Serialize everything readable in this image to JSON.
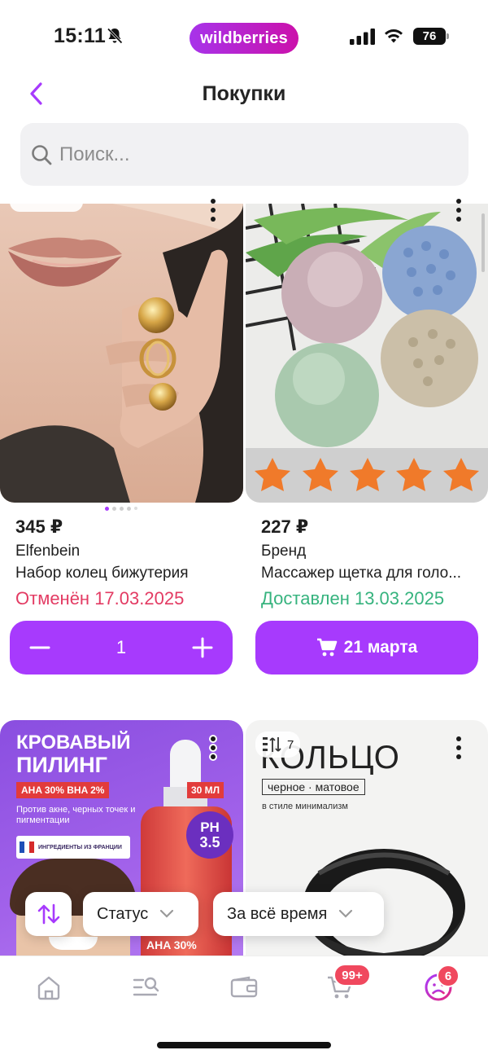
{
  "status_bar": {
    "time": "15:11",
    "brand": "wildberries",
    "battery": "76"
  },
  "header": {
    "title": "Покупки"
  },
  "search": {
    "placeholder": "Поиск..."
  },
  "products": [
    {
      "price": "345 ₽",
      "brand": "Elfenbein",
      "name": "Набор колец бижутерия",
      "status": "Отменён 17.03.2025",
      "quantity": "1"
    },
    {
      "price": "227 ₽",
      "brand": "Бренд",
      "name": "Массажер щетка для голо...",
      "status": "Доставлен 13.03.2025",
      "delivery_button": "21 марта"
    },
    {
      "image_text": {
        "headline_1": "КРОВАВЫЙ",
        "headline_2": "ПИЛИНГ",
        "acids": "AHA 30% BHA 2%",
        "volume": "30 МЛ",
        "description": "Против акне, черных точек и пигментации",
        "ingredients": "ИНГРЕДИЕНТЫ ИЗ ФРАНЦИИ",
        "ph_label": "PH",
        "ph_value": "3.5",
        "bottle_text": "AHA 30%"
      }
    },
    {
      "compare_count": "7",
      "image_text": {
        "headline": "КОЛЬЦО",
        "subtitle": "черное · матовое",
        "tagline": "в стиле минимализм"
      }
    }
  ],
  "filters": {
    "status_label": "Статус",
    "period_label": "За всё время"
  },
  "tabbar": {
    "cart_badge": "99+",
    "profile_badge": "6"
  },
  "colors": {
    "accent": "#a73afd",
    "cancelled": "#e33b63",
    "delivered": "#36b37e",
    "badge": "#f0485e"
  }
}
